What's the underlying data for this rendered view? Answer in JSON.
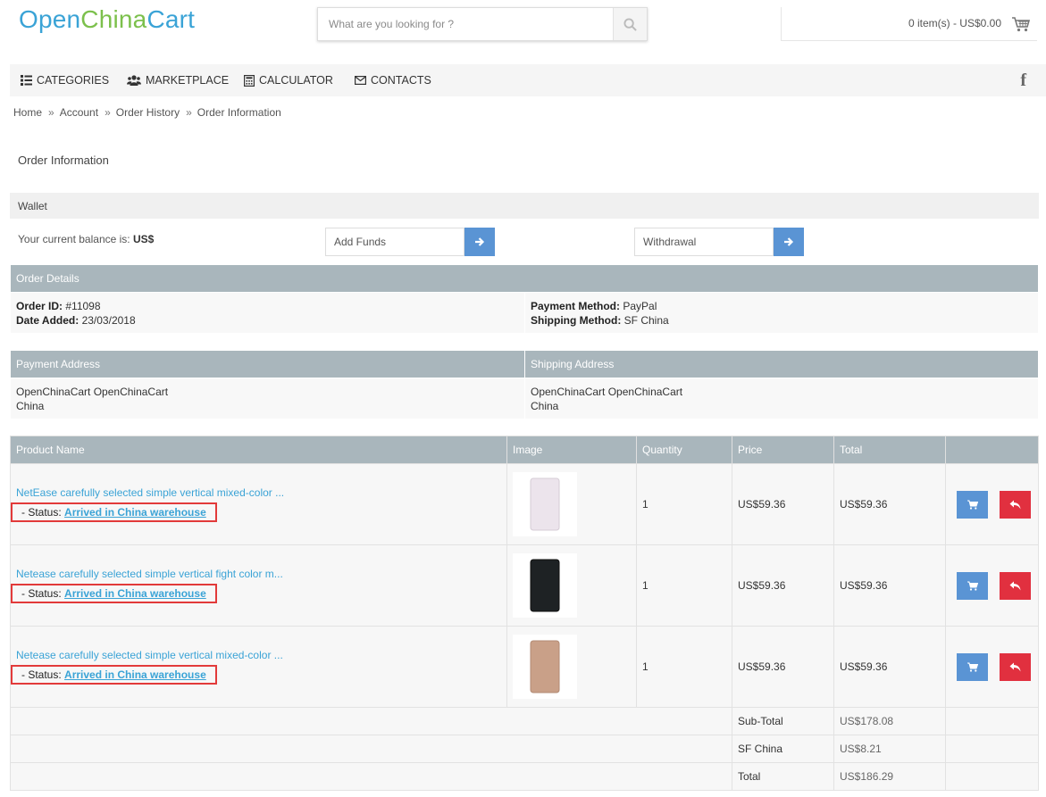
{
  "logo": {
    "part1": "Open",
    "part2": "China",
    "part3": "Cart"
  },
  "search": {
    "placeholder": "What are you looking for ?"
  },
  "cart": {
    "summary": "0 item(s) - US$0.00"
  },
  "nav": {
    "items": [
      {
        "label": "CATEGORIES",
        "icon": "list-icon"
      },
      {
        "label": "MARKETPLACE",
        "icon": "users-icon"
      },
      {
        "label": "CALCULATOR",
        "icon": "calculator-icon"
      },
      {
        "label": "CONTACTS",
        "icon": "envelope-icon"
      }
    ],
    "social": "f"
  },
  "breadcrumb": [
    "Home",
    "Account",
    "Order History",
    "Order Information"
  ],
  "page_title": "Order Information",
  "wallet": {
    "title": "Wallet",
    "balance_label": "Your current balance is:",
    "balance_value": "US$",
    "add_funds_placeholder": "Add Funds",
    "withdrawal_placeholder": "Withdrawal"
  },
  "order_details": {
    "title": "Order Details",
    "order_id_label": "Order ID:",
    "order_id": "#11098",
    "date_label": "Date Added:",
    "date": "23/03/2018",
    "payment_label": "Payment Method:",
    "payment": "PayPal",
    "shipping_label": "Shipping Method:",
    "shipping": "SF China"
  },
  "addresses": {
    "payment_title": "Payment Address",
    "shipping_title": "Shipping Address",
    "payment_name": "OpenChinaCart OpenChinaCart",
    "payment_country": "China",
    "shipping_name": "OpenChinaCart OpenChinaCart",
    "shipping_country": "China"
  },
  "products_table": {
    "headers": [
      "Product Name",
      "Image",
      "Quantity",
      "Price",
      "Total",
      ""
    ],
    "status_label": "- Status:",
    "rows": [
      {
        "name": "NetEase carefully selected simple vertical mixed-color ...",
        "status": "Arrived in China warehouse",
        "qty": "1",
        "price": "US$59.36",
        "total": "US$59.36",
        "color": "#ece4ec"
      },
      {
        "name": "Netease carefully selected simple vertical fight color m...",
        "status": "Arrived in China warehouse",
        "qty": "1",
        "price": "US$59.36",
        "total": "US$59.36",
        "color": "#1e2224"
      },
      {
        "name": "Netease carefully selected simple vertical mixed-color ...",
        "status": "Arrived in China warehouse",
        "qty": "1",
        "price": "US$59.36",
        "total": "US$59.36",
        "color": "#c9a088"
      }
    ]
  },
  "totals": [
    {
      "label": "Sub-Total",
      "value": "US$178.08"
    },
    {
      "label": "SF China",
      "value": "US$8.21"
    },
    {
      "label": "Total",
      "value": "US$186.29"
    }
  ],
  "colors": {
    "accent_blue": "#5a94d4",
    "danger_red": "#e1303f",
    "link": "#3aa3d6",
    "table_header": "#a9b6bc"
  }
}
